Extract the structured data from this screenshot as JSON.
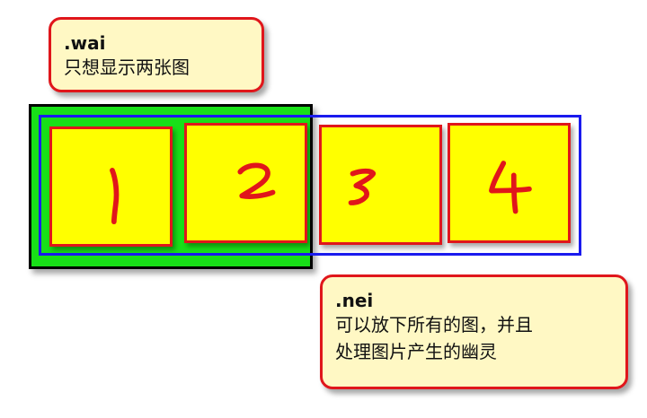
{
  "wai_callout": {
    "title": ".wai",
    "description": "只想显示两张图"
  },
  "nei_callout": {
    "title": ".nei",
    "description_line1": "可以放下所有的图，并且",
    "description_line2": "处理图片产生的幽灵"
  },
  "tiles": [
    {
      "label": "1"
    },
    {
      "label": "2"
    },
    {
      "label": "3"
    },
    {
      "label": "4"
    }
  ],
  "colors": {
    "wai_fill": "#18e018",
    "wai_border": "#000000",
    "nei_border": "#1a1aee",
    "tile_fill": "#ffff00",
    "tile_border": "#e0161b",
    "callout_fill": "#fff8c4",
    "callout_border": "#e0161b",
    "digit_color": "#e0161b"
  }
}
